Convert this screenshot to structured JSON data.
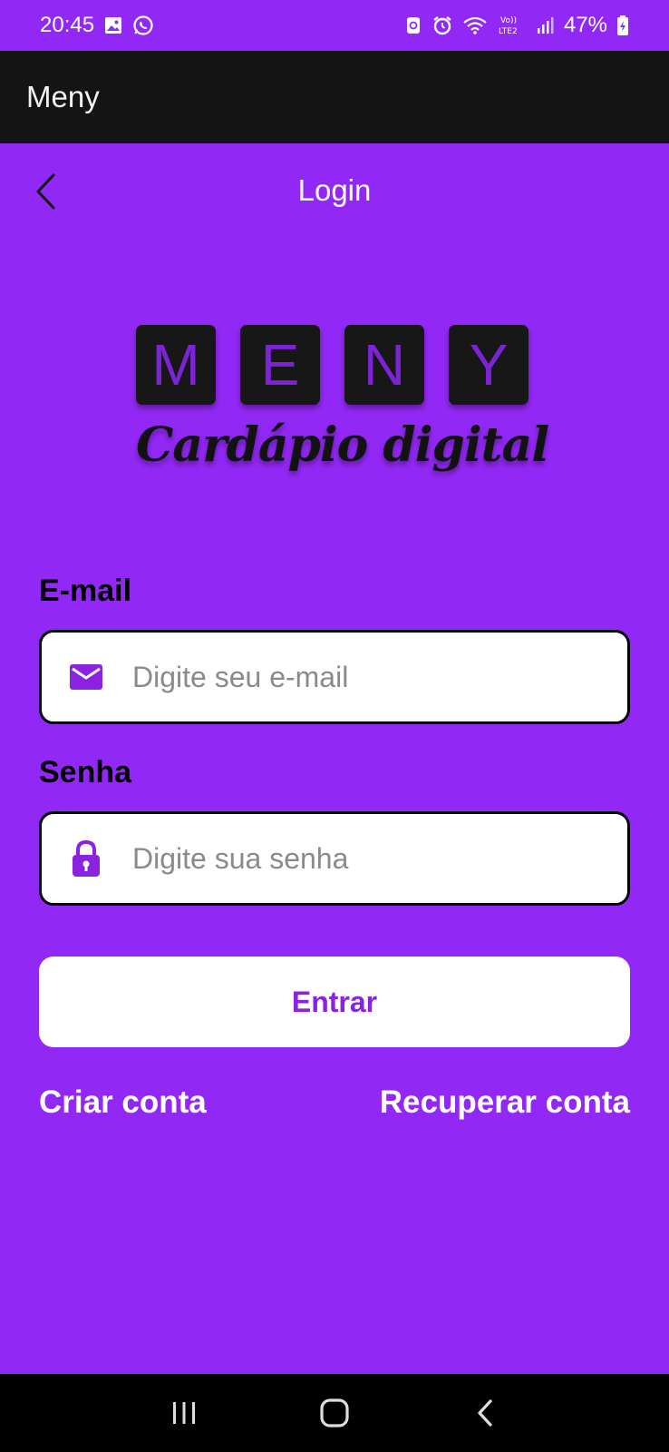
{
  "status_bar": {
    "time": "20:45",
    "battery": "47%",
    "icons": [
      "gallery-icon",
      "whatsapp-icon",
      "accessibility-icon",
      "alarm-icon",
      "wifi-icon",
      "volte-lte2-icon",
      "signal-icon",
      "battery-charging-icon"
    ]
  },
  "app_bar": {
    "title": "Meny"
  },
  "header": {
    "title": "Login",
    "back_icon": "chevron-left-icon"
  },
  "logo": {
    "letters": [
      "M",
      "E",
      "N",
      "Y"
    ],
    "subtitle": "Cardápio digital"
  },
  "form": {
    "email": {
      "label": "E-mail",
      "placeholder": "Digite seu e-mail",
      "value": "",
      "icon": "mail-icon"
    },
    "password": {
      "label": "Senha",
      "placeholder": "Digite sua senha",
      "value": "",
      "icon": "lock-icon"
    },
    "submit_label": "Entrar"
  },
  "links": {
    "create_account": "Criar conta",
    "recover_account": "Recuperar conta"
  },
  "nav": {
    "icons": [
      "recent-apps-icon",
      "home-icon",
      "back-icon"
    ]
  },
  "colors": {
    "primary": "#9228f5",
    "accent": "#8a22e0",
    "app_bar": "#141414"
  }
}
